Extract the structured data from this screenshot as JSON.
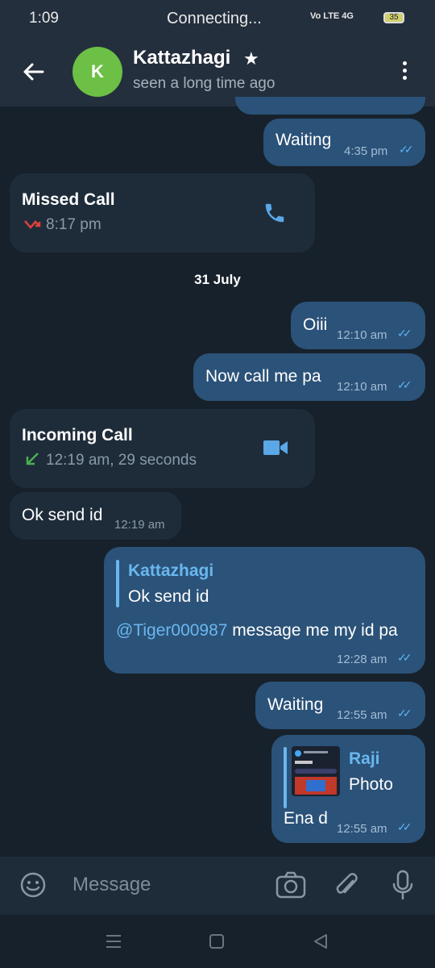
{
  "status_bar": {
    "time": "1:09",
    "connecting": "Connecting...",
    "network": "Vo LTE  4G",
    "battery": "35"
  },
  "header": {
    "avatar_letter": "K",
    "name": "Kattazhagi",
    "status": "seen a long time ago"
  },
  "messages": {
    "m1": {
      "text": "Waiting",
      "time": "4:35 pm"
    },
    "call1": {
      "title": "Missed Call",
      "time": "8:17 pm"
    },
    "date": "31 July",
    "m2": {
      "text": "Oiii",
      "time": "12:10 am"
    },
    "m3": {
      "text": "Now call me pa",
      "time": "12:10 am"
    },
    "call2": {
      "title": "Incoming Call",
      "time": "12:19 am, 29 seconds"
    },
    "m4": {
      "text": "Ok send id",
      "time": "12:19 am"
    },
    "m5": {
      "reply_name": "Kattazhagi",
      "reply_text": "Ok send id",
      "mention": "@Tiger000987",
      "text": " message me my id pa",
      "time": "12:28 am"
    },
    "m6": {
      "text": "Waiting",
      "time": "12:55 am"
    },
    "m7": {
      "reply_name": "Raji",
      "reply_text": "Photo",
      "text": "Ena d",
      "time": "12:55 am"
    }
  },
  "input": {
    "placeholder": "Message"
  },
  "icons": [
    "back-arrow-icon",
    "star-icon",
    "more-vert-icon",
    "phone-icon",
    "video-icon",
    "missed-call-icon",
    "incoming-call-icon",
    "emoji-icon",
    "camera-icon",
    "attach-icon",
    "mic-icon",
    "recents-icon",
    "home-icon",
    "back-nav-icon"
  ],
  "colors": {
    "background": "#17212b",
    "outgoing": "#2b5278",
    "incoming": "#1e2c3a",
    "accent": "#6ab7f0",
    "avatar": "#6cc045",
    "missed": "#e0403a",
    "incoming_arrow": "#4caf50"
  }
}
